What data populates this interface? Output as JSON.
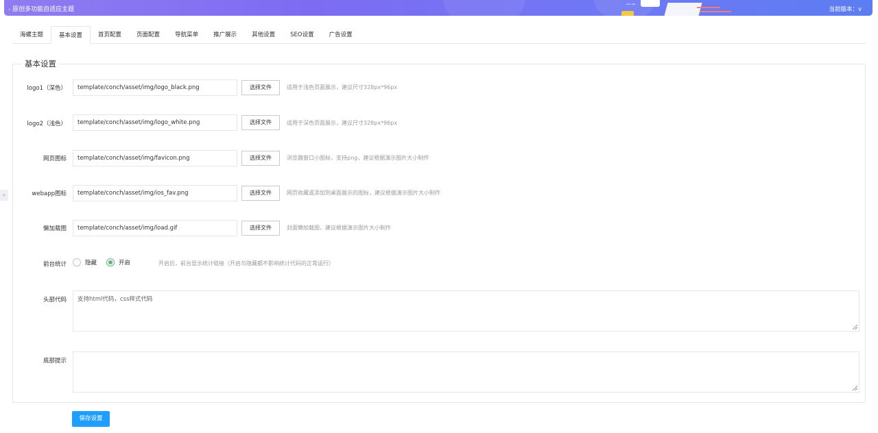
{
  "header": {
    "title": "- 原创多功能自适应主题",
    "version_label": "当前版本：v"
  },
  "tabs": [
    {
      "label": "海螺主题"
    },
    {
      "label": "基本设置",
      "active": true
    },
    {
      "label": "首页配置"
    },
    {
      "label": "页面配置"
    },
    {
      "label": "导航菜单"
    },
    {
      "label": "推广展示"
    },
    {
      "label": "其他设置"
    },
    {
      "label": "SEO设置"
    },
    {
      "label": "广告设置"
    }
  ],
  "section": {
    "legend": "基本设置"
  },
  "fields": [
    {
      "label": "logo1（深色）",
      "value": "template/conch/asset/img/logo_black.png",
      "button": "选择文件",
      "hint": "适用于浅色页面展示，建议尺寸328px*96px"
    },
    {
      "label": "logo2（浅色）",
      "value": "template/conch/asset/img/logo_white.png",
      "button": "选择文件",
      "hint": "适用于深色页面展示，建议尺寸328px*96px"
    },
    {
      "label": "网页图标",
      "value": "template/conch/asset/img/favicon.png",
      "button": "选择文件",
      "hint": "浏览器窗口小图标，支持png，建议根据演示图片大小制作"
    },
    {
      "label": "webapp图标",
      "value": "template/conch/asset/img/ios_fav.png",
      "button": "选择文件",
      "hint": "网页收藏或添加到桌面展示的图标，建议根据演示图片大小制作"
    },
    {
      "label": "懒加载图",
      "value": "template/conch/asset/img/load.gif",
      "button": "选择文件",
      "hint": "封面懒加载图，建议根据演示图片大小制作"
    }
  ],
  "stats": {
    "label": "前台统计",
    "options": [
      {
        "label": "隐藏",
        "checked": false
      },
      {
        "label": "开启",
        "checked": true
      }
    ],
    "hint": "开启后，前台显示统计链接（开启与隐藏都不影响统计代码的正常运行）"
  },
  "head_code": {
    "label": "头部代码",
    "placeholder": "支持html代码，css样式代码"
  },
  "footer_tip": {
    "label": "底部提示",
    "value": ""
  },
  "save_button": "保存设置",
  "colors": {
    "accent": "#1e9fff",
    "radio_checked": "#5fb878",
    "banner_start": "#8f7cf0",
    "banner_end": "#5c7df2"
  }
}
